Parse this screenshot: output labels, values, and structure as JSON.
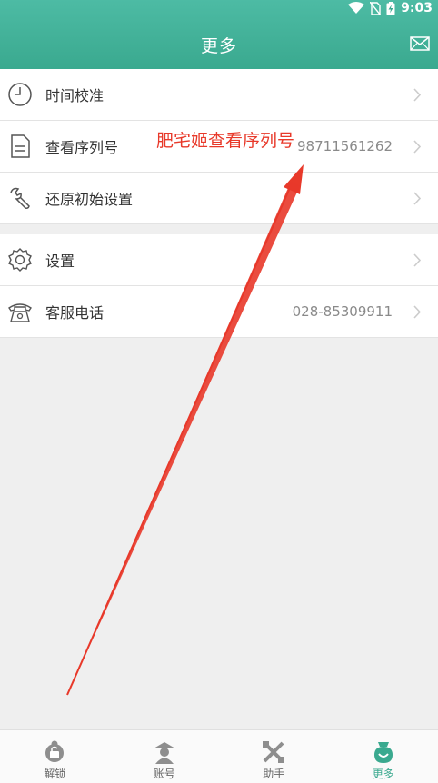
{
  "status_bar": {
    "time": "9:03",
    "icons": [
      "wifi-icon",
      "no-sim-icon",
      "battery-charging-icon"
    ]
  },
  "header": {
    "title": "更多",
    "right_icon": "mail-icon"
  },
  "menu_group_1": [
    {
      "label": "时间校准",
      "value": "",
      "icon": "clock-icon"
    },
    {
      "label": "查看序列号",
      "value": "98711561262",
      "icon": "document-icon"
    },
    {
      "label": "还原初始设置",
      "value": "",
      "icon": "wrench-icon"
    }
  ],
  "menu_group_2": [
    {
      "label": "设置",
      "value": "",
      "icon": "gear-icon"
    },
    {
      "label": "客服电话",
      "value": "028-85309911",
      "icon": "telephone-icon"
    }
  ],
  "annotation": {
    "text": "肥宅姬查看序列号",
    "color": "#e8392a"
  },
  "tabs": [
    {
      "label": "解锁",
      "icon": "unlock-tab-icon",
      "active": false
    },
    {
      "label": "账号",
      "icon": "account-tab-icon",
      "active": false
    },
    {
      "label": "助手",
      "icon": "assistant-tab-icon",
      "active": false
    },
    {
      "label": "更多",
      "icon": "more-tab-icon",
      "active": true
    }
  ],
  "colors": {
    "brand": "#3aa98f",
    "annotation": "#e8392a"
  }
}
